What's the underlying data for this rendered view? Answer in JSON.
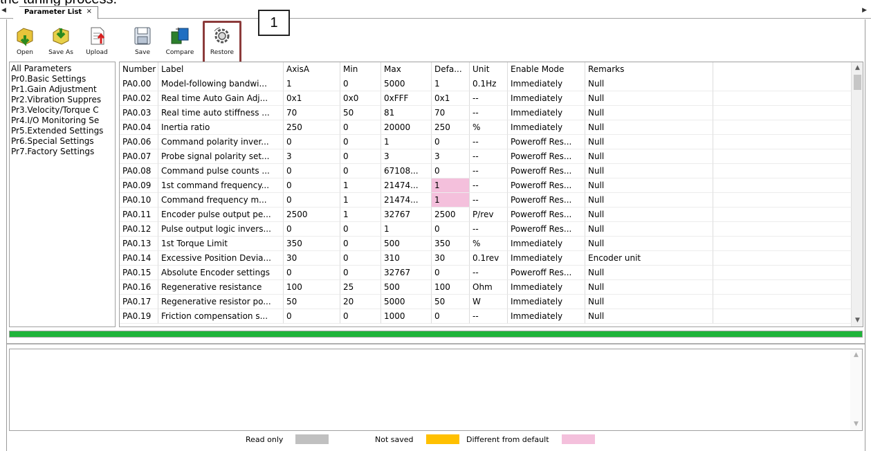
{
  "caption": "the tuning process.",
  "tab": {
    "title": "Parameter List",
    "close": "×",
    "scroll_left": "◀",
    "scroll_right": "▶"
  },
  "toolbar": {
    "open": "Open",
    "save_as": "Save As",
    "upload": "Upload",
    "save": "Save",
    "compare": "Compare",
    "restore": "Restore"
  },
  "callout_number": "1",
  "tree": {
    "items": [
      "All Parameters",
      "Pr0.Basic Settings",
      "Pr1.Gain Adjustment",
      "Pr2.Vibration Suppres",
      "Pr3.Velocity/Torque C",
      "Pr4.I/O Monitoring Se",
      "Pr5.Extended Settings",
      "Pr6.Special Settings",
      "Pr7.Factory Settings"
    ]
  },
  "grid": {
    "columns": [
      "Number",
      "Label",
      "AxisA",
      "Min",
      "Max",
      "Defa...",
      "Unit",
      "Enable Mode",
      "Remarks"
    ],
    "rows": [
      [
        "PA0.00",
        "Model-following bandwi...",
        "1",
        "0",
        "5000",
        "1",
        "0.1Hz",
        "Immediately",
        "Null"
      ],
      [
        "PA0.02",
        "Real time Auto Gain Adj...",
        "0x1",
        "0x0",
        "0xFFF",
        "0x1",
        "--",
        "Immediately",
        "Null"
      ],
      [
        "PA0.03",
        "Real time auto stiffness ...",
        "70",
        "50",
        "81",
        "70",
        "--",
        "Immediately",
        "Null"
      ],
      [
        "PA0.04",
        "Inertia ratio",
        "250",
        "0",
        "20000",
        "250",
        "%",
        "Immediately",
        "Null"
      ],
      [
        "PA0.06",
        "Command polarity inver...",
        "0",
        "0",
        "1",
        "0",
        "--",
        "Poweroff Res...",
        "Null"
      ],
      [
        "PA0.07",
        "Probe signal polarity set...",
        "3",
        "0",
        "3",
        "3",
        "--",
        "Poweroff Res...",
        "Null"
      ],
      [
        "PA0.08",
        "Command pulse counts ...",
        "0",
        "0",
        "67108...",
        "0",
        "--",
        "Poweroff Res...",
        "Null"
      ],
      [
        "PA0.09",
        "1st command frequency...",
        "0",
        "1",
        "21474...",
        "1",
        "--",
        "Poweroff Res...",
        "Null"
      ],
      [
        "PA0.10",
        "Command frequency m...",
        "0",
        "1",
        "21474...",
        "1",
        "--",
        "Poweroff Res...",
        "Null"
      ],
      [
        "PA0.11",
        "Encoder pulse output pe...",
        "2500",
        "1",
        "32767",
        "2500",
        "P/rev",
        "Poweroff Res...",
        "Null"
      ],
      [
        "PA0.12",
        "Pulse output logic invers...",
        "0",
        "0",
        "1",
        "0",
        "--",
        "Poweroff Res...",
        "Null"
      ],
      [
        "PA0.13",
        "1st Torque Limit",
        "350",
        "0",
        "500",
        "350",
        "%",
        "Immediately",
        "Null"
      ],
      [
        "PA0.14",
        "Excessive Position Devia...",
        "30",
        "0",
        "310",
        "30",
        "0.1rev",
        "Immediately",
        "Encoder unit"
      ],
      [
        "PA0.15",
        "Absolute Encoder settings",
        "0",
        "0",
        "32767",
        "0",
        "--",
        "Poweroff Res...",
        "Null"
      ],
      [
        "PA0.16",
        "Regenerative resistance",
        "100",
        "25",
        "500",
        "100",
        "Ohm",
        "Immediately",
        "Null"
      ],
      [
        "PA0.17",
        "Regenerative resistor po...",
        "50",
        "20",
        "5000",
        "50",
        "W",
        "Immediately",
        "Null"
      ],
      [
        "PA0.19",
        "Friction compensation s...",
        "0",
        "0",
        "1000",
        "0",
        "--",
        "Immediately",
        "Null"
      ]
    ],
    "highlight_rows": [
      7,
      8
    ],
    "highlight_col": 5
  },
  "progress": {
    "fraction": 1.0,
    "color": "#1fb43a"
  },
  "legend": {
    "read_only": "Read only",
    "not_saved": "Not saved",
    "different": "Different from default",
    "colors": {
      "read_only": "#c0c0c0",
      "not_saved": "#ffc000",
      "different": "#f4c0dc"
    }
  }
}
